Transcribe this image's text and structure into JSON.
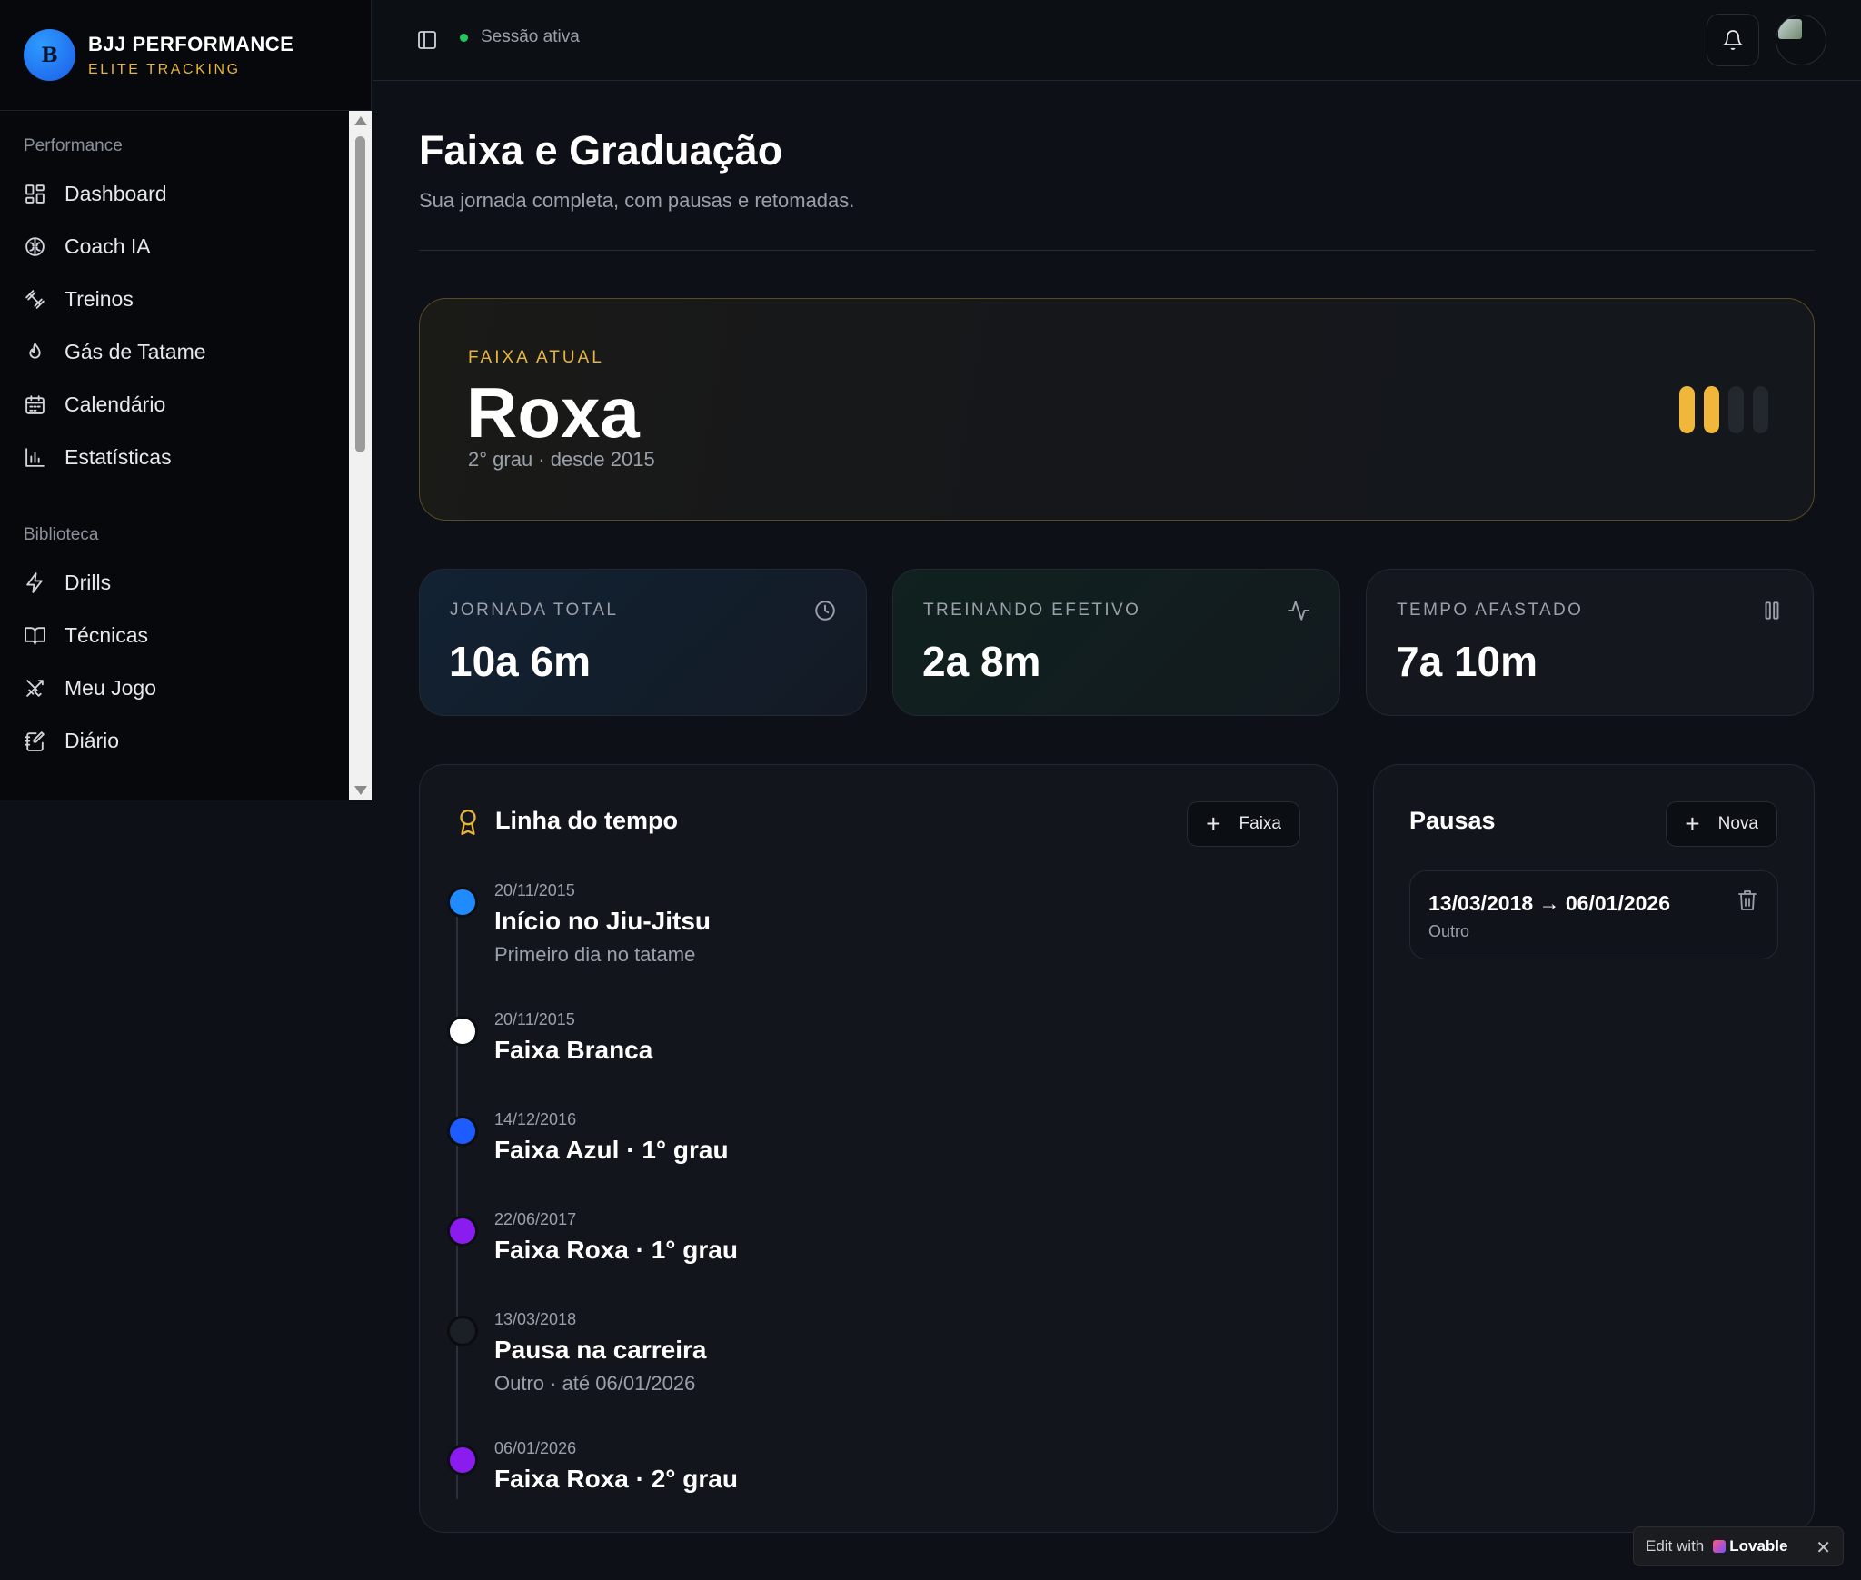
{
  "brand": {
    "initial": "B",
    "title": "BJJ PERFORMANCE",
    "subtitle": "ELITE TRACKING"
  },
  "sidebar": {
    "groups": [
      {
        "label": "Performance",
        "items": [
          {
            "label": "Dashboard",
            "icon": "dashboard-icon"
          },
          {
            "label": "Coach IA",
            "icon": "brain-icon"
          },
          {
            "label": "Treinos",
            "icon": "dumbbell-icon"
          },
          {
            "label": "Gás de Tatame",
            "icon": "flame-icon"
          },
          {
            "label": "Calendário",
            "icon": "calendar-icon"
          },
          {
            "label": "Estatísticas",
            "icon": "bar-chart-icon"
          }
        ]
      },
      {
        "label": "Biblioteca",
        "items": [
          {
            "label": "Drills",
            "icon": "zap-icon"
          },
          {
            "label": "Técnicas",
            "icon": "book-icon"
          },
          {
            "label": "Meu Jogo",
            "icon": "swords-icon"
          },
          {
            "label": "Diário",
            "icon": "notebook-pen-icon"
          }
        ]
      }
    ]
  },
  "topbar": {
    "session_status": "Sessão ativa",
    "session_color": "#22c55e"
  },
  "header": {
    "title": "Faixa e Graduação",
    "subtitle": "Sua jornada completa, com pausas e retomadas."
  },
  "current_belt": {
    "label": "FAIXA ATUAL",
    "belt": "Roxa",
    "meta": "2° grau · desde 2015",
    "degrees_earned": 2,
    "degrees_total": 4,
    "stripe_color_on": "#f0b73a",
    "stripe_color_off": "#23272e"
  },
  "stats": [
    {
      "label": "JORNADA TOTAL",
      "value": "10a 6m",
      "icon": "clock-icon"
    },
    {
      "label": "TREINANDO EFETIVO",
      "value": "2a 8m",
      "icon": "activity-icon"
    },
    {
      "label": "TEMPO AFASTADO",
      "value": "7a 10m",
      "icon": "pause-icon"
    }
  ],
  "timeline": {
    "title": "Linha do tempo",
    "add_label": "Faixa",
    "events": [
      {
        "date": "20/11/2015",
        "title": "Início no Jiu-Jitsu",
        "note": "Primeiro dia no tatame",
        "color": "#1f8bff"
      },
      {
        "date": "20/11/2015",
        "title": "Faixa Branca",
        "note": "",
        "color": "#ffffff"
      },
      {
        "date": "14/12/2016",
        "title": "Faixa Azul · 1° grau",
        "note": "",
        "color": "#1d5cff"
      },
      {
        "date": "22/06/2017",
        "title": "Faixa Roxa · 1° grau",
        "note": "",
        "color": "#8a1cf0"
      },
      {
        "date": "13/03/2018",
        "title": "Pausa na carreira",
        "note": "Outro · até 06/01/2026",
        "color": "#1b1f26"
      },
      {
        "date": "06/01/2026",
        "title": "Faixa Roxa · 2° grau",
        "note": "",
        "color": "#8a1cf0"
      }
    ]
  },
  "pauses": {
    "title": "Pausas",
    "add_label": "Nova",
    "items": [
      {
        "range": "13/03/2018 → 06/01/2026",
        "reason": "Outro"
      }
    ]
  },
  "badge": {
    "prefix": "Edit with",
    "brand": "Lovable",
    "close": "✕"
  }
}
